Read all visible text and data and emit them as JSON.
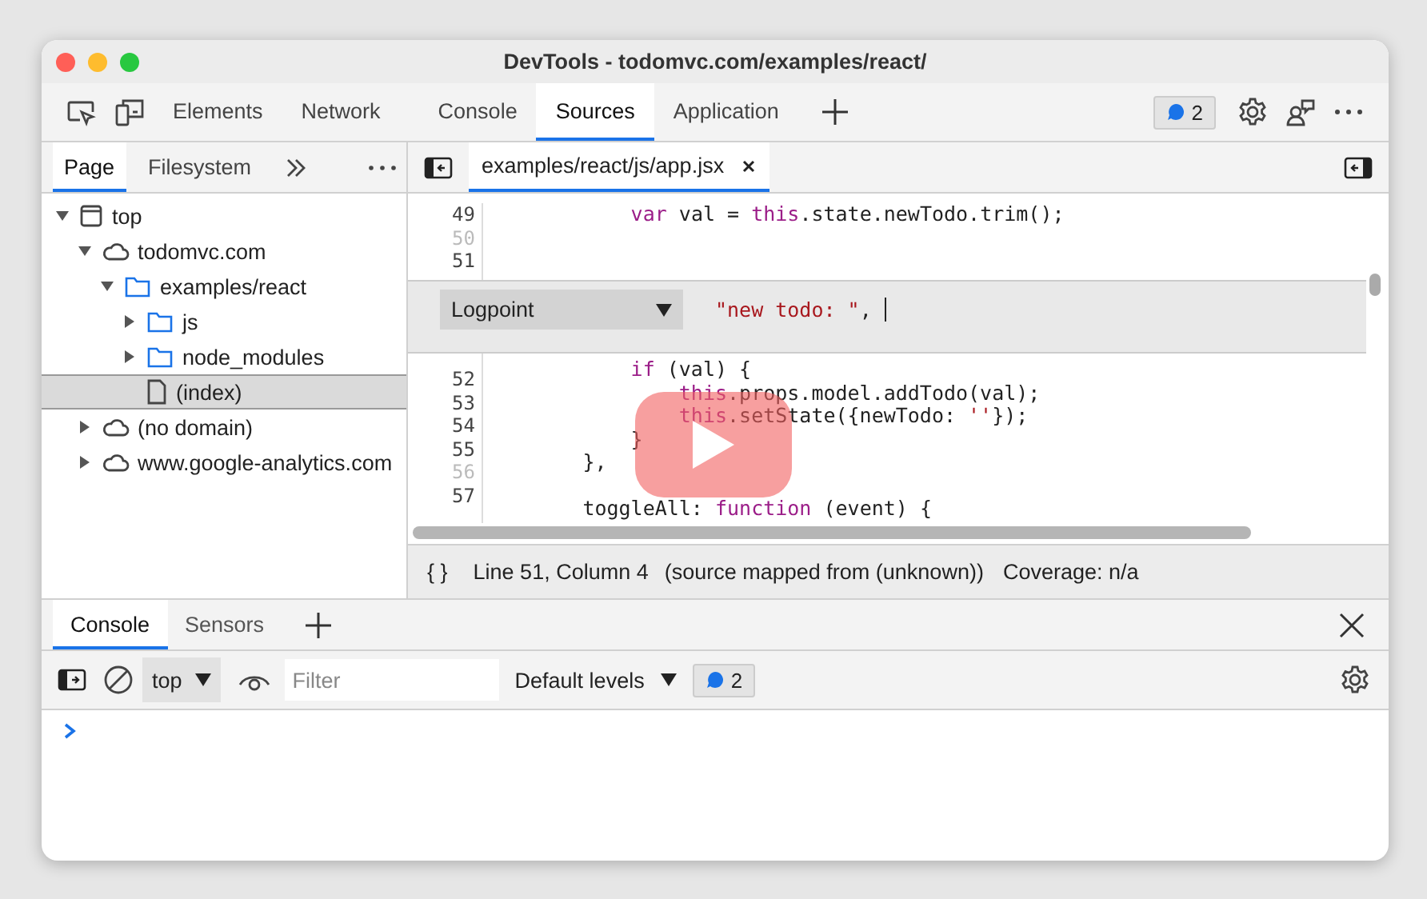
{
  "window": {
    "title": "DevTools - todomvc.com/examples/react/"
  },
  "toolbar": {
    "tabs": [
      {
        "label": "Elements",
        "selected": false
      },
      {
        "label": "Network",
        "selected": false
      },
      {
        "label": "Console",
        "selected": false
      },
      {
        "label": "Sources",
        "selected": true
      },
      {
        "label": "Application",
        "selected": false
      }
    ],
    "issues_count": "2"
  },
  "navigator": {
    "tabs": [
      {
        "label": "Page",
        "selected": true
      },
      {
        "label": "Filesystem",
        "selected": false
      }
    ],
    "tree": [
      {
        "label": "top",
        "kind": "frame",
        "expanded": true,
        "selected": false,
        "children": [
          {
            "label": "todomvc.com",
            "kind": "domain",
            "expanded": true,
            "selected": false,
            "children": [
              {
                "label": "examples/react",
                "kind": "folder",
                "expanded": true,
                "selected": false,
                "children": [
                  {
                    "label": "js",
                    "kind": "folder",
                    "expanded": false,
                    "selected": false
                  },
                  {
                    "label": "node_modules",
                    "kind": "folder",
                    "expanded": false,
                    "selected": false
                  },
                  {
                    "label": "(index)",
                    "kind": "file",
                    "selected": true
                  }
                ]
              }
            ]
          },
          {
            "label": "(no domain)",
            "kind": "domain",
            "expanded": false,
            "selected": false
          },
          {
            "label": "www.google-analytics.com",
            "kind": "domain",
            "expanded": false,
            "selected": false
          }
        ]
      }
    ]
  },
  "editor": {
    "tabs": [
      {
        "label": "examples/react/js/app.jsx",
        "selected": true
      }
    ],
    "code_top": {
      "numbers": [
        {
          "text": "49",
          "dim": false
        },
        {
          "text": "50",
          "dim": true
        },
        {
          "text": "51",
          "dim": false
        }
      ],
      "lines": [
        {
          "tokens": [
            {
              "kind": "keyword",
              "text": "            var"
            },
            {
              "kind": "plain",
              "text": " val = "
            },
            {
              "kind": "keyword",
              "text": "this"
            },
            {
              "kind": "plain",
              "text": ".state.newTodo.trim();"
            }
          ]
        }
      ]
    },
    "logpoint": {
      "type": "Logpoint",
      "tokens": [
        {
          "kind": "string",
          "text": "\"new todo: \""
        },
        {
          "kind": "plain",
          "text": ", "
        }
      ]
    },
    "code_bottom": {
      "numbers": [
        {
          "text": "52",
          "dim": false
        },
        {
          "text": "53",
          "dim": false
        },
        {
          "text": "54",
          "dim": false
        },
        {
          "text": "55",
          "dim": false
        },
        {
          "text": "56",
          "dim": true
        },
        {
          "text": "57",
          "dim": false
        }
      ],
      "lines": [
        {
          "gap_before": false,
          "tokens": [
            {
              "kind": "keyword",
              "text": "            if"
            },
            {
              "kind": "plain",
              "text": " (val) {"
            }
          ]
        },
        {
          "gap_before": false,
          "tokens": [
            {
              "kind": "keyword",
              "text": "                this"
            },
            {
              "kind": "plain",
              "text": ".props.model.addTodo(val);"
            }
          ]
        },
        {
          "gap_before": false,
          "tokens": [
            {
              "kind": "keyword",
              "text": "                this"
            },
            {
              "kind": "plain",
              "text": ".setState({newTodo: "
            },
            {
              "kind": "string",
              "text": "''"
            },
            {
              "kind": "plain",
              "text": "});"
            }
          ]
        },
        {
          "gap_before": false,
          "tokens": [
            {
              "kind": "plain",
              "text": "            }"
            }
          ]
        },
        {
          "gap_before": false,
          "tokens": [
            {
              "kind": "plain",
              "text": "        },"
            }
          ]
        },
        {
          "gap_before": true,
          "tokens": [
            {
              "kind": "plain",
              "text": "        toggleAll: "
            },
            {
              "kind": "keyword",
              "text": "function"
            },
            {
              "kind": "plain",
              "text": " (event) {"
            }
          ]
        }
      ]
    },
    "status": {
      "pretty_print": "{ }",
      "position": "Line 51, Column 4",
      "source_map": "(source mapped from (unknown))",
      "coverage": "Coverage: n/a"
    }
  },
  "drawer": {
    "tabs": [
      {
        "label": "Console",
        "selected": true
      },
      {
        "label": "Sensors",
        "selected": false
      }
    ],
    "context": "top",
    "filter": {
      "placeholder": "Filter"
    },
    "levels": "Default levels",
    "issues_count": "2"
  }
}
